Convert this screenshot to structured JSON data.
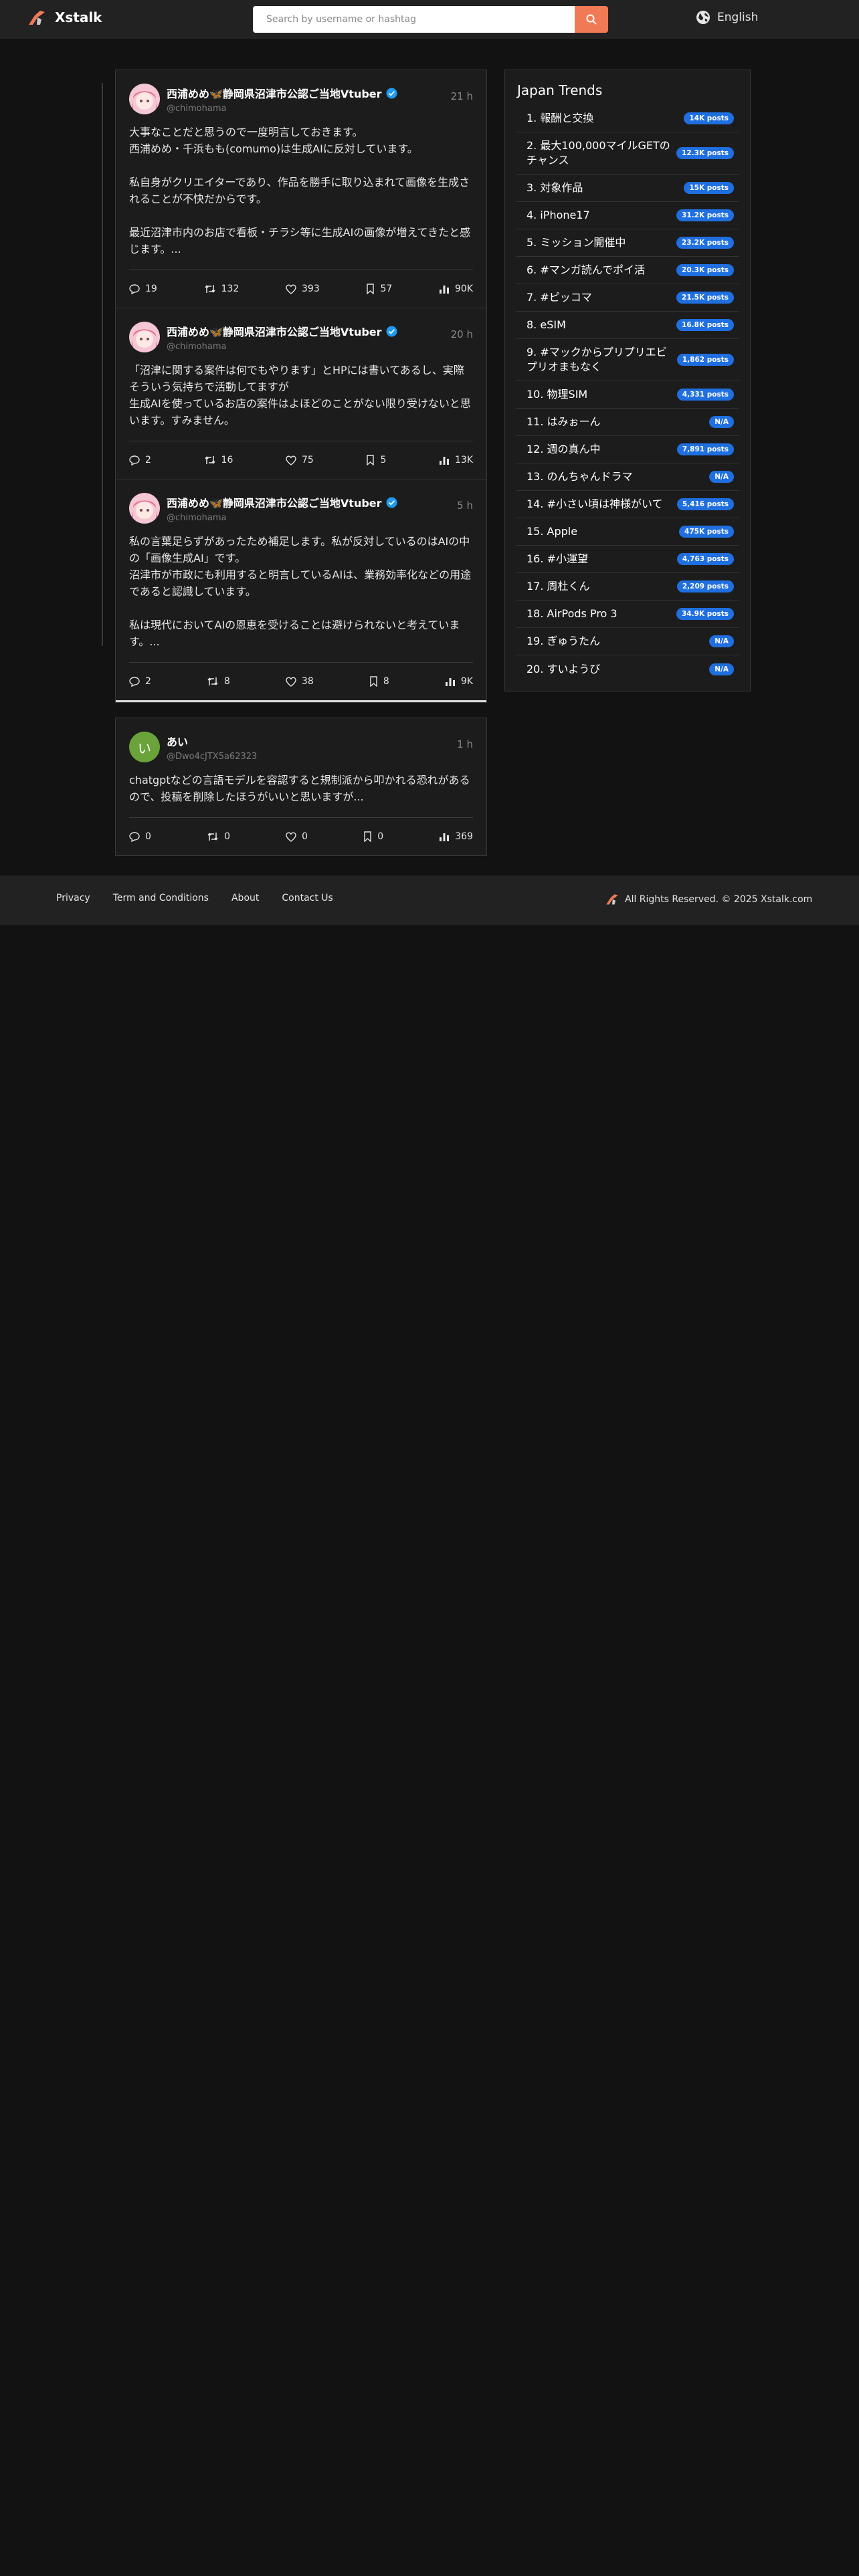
{
  "header": {
    "brand": "Xstalk",
    "search_placeholder": "Search by username or hashtag",
    "language": "English"
  },
  "thread_posts": [
    {
      "name": "西浦めめ🦋静岡県沼津市公認ご当地Vtuber",
      "handle": "@chimohama",
      "time": "21 h",
      "body": "大事なことだと思うので一度明言しておきます。\n西浦めめ・千浜もも(comumo)は生成AIに反対しています。\n\n私自身がクリエイターであり、作品を勝手に取り込まれて画像を生成されることが不快だからです。\n\n最近沼津市内のお店で看板・チラシ等に生成AIの画像が増えてきたと感じます。...",
      "replies": "19",
      "retweets": "132",
      "likes": "393",
      "bookmarks": "57",
      "views": "90K"
    },
    {
      "name": "西浦めめ🦋静岡県沼津市公認ご当地Vtuber",
      "handle": "@chimohama",
      "time": "20 h",
      "body": "「沼津に関する案件は何でもやります」とHPには書いてあるし、実際そういう気持ちで活動してますが\n生成AIを使っているお店の案件はよほどのことがない限り受けないと思います。すみません。",
      "replies": "2",
      "retweets": "16",
      "likes": "75",
      "bookmarks": "5",
      "views": "13K"
    },
    {
      "name": "西浦めめ🦋静岡県沼津市公認ご当地Vtuber",
      "handle": "@chimohama",
      "time": "5 h",
      "body": "私の言葉足らずがあったため補足します。私が反対しているのはAIの中の「画像生成AI」です。\n沼津市が市政にも利用すると明言しているAIは、業務効率化などの用途であると認識しています。\n\n私は現代においてAIの恩恵を受けることは避けられないと考えています。...",
      "replies": "2",
      "retweets": "8",
      "likes": "38",
      "bookmarks": "8",
      "views": "9K"
    }
  ],
  "single_post": {
    "avatar_letter": "い",
    "name": "あい",
    "handle": "@Dwo4cJTX5a62323",
    "time": "1 h",
    "body": "chatgptなどの言語モデルを容認すると規制派から叩かれる恐れがあるので、投稿を削除したほうがいいと思いますが...",
    "replies": "0",
    "retweets": "0",
    "likes": "0",
    "bookmarks": "0",
    "views": "369"
  },
  "trends": {
    "title": "Japan Trends",
    "items": [
      {
        "label": "1. 報酬と交換",
        "count": "14K posts"
      },
      {
        "label": "2. 最大100,000マイルGETのチャンス",
        "count": "12.3K posts"
      },
      {
        "label": "3. 対象作品",
        "count": "15K posts"
      },
      {
        "label": "4. iPhone17",
        "count": "31.2K posts"
      },
      {
        "label": "5. ミッション開催中",
        "count": "23.2K posts"
      },
      {
        "label": "6. #マンガ読んでポイ活",
        "count": "20.3K posts"
      },
      {
        "label": "7. #ピッコマ",
        "count": "21.5K posts"
      },
      {
        "label": "8. eSIM",
        "count": "16.8K posts"
      },
      {
        "label": "9. #マックからプリプリエビプリオまもなく",
        "count": "1,862 posts"
      },
      {
        "label": "10. 物理SIM",
        "count": "4,331 posts"
      },
      {
        "label": "11. はみぉーん",
        "count": "N/A"
      },
      {
        "label": "12. 週の真ん中",
        "count": "7,891 posts"
      },
      {
        "label": "13. のんちゃんドラマ",
        "count": "N/A"
      },
      {
        "label": "14. #小さい頃は神様がいて",
        "count": "5,416 posts"
      },
      {
        "label": "15. Apple",
        "count": "475K posts"
      },
      {
        "label": "16. #小運望",
        "count": "4,763 posts"
      },
      {
        "label": "17. 周杜くん",
        "count": "2,209 posts"
      },
      {
        "label": "18. AirPods Pro 3",
        "count": "34.9K posts"
      },
      {
        "label": "19. ぎゅうたん",
        "count": "N/A"
      },
      {
        "label": "20. すいようび",
        "count": "N/A"
      }
    ]
  },
  "footer": {
    "links": [
      "Privacy",
      "Term and Conditions",
      "About",
      "Contact Us"
    ],
    "copyright": "All Rights Reserved. © 2025 Xstalk.com"
  },
  "colors": {
    "accent": "#f07a55",
    "badge": "#1f6fe0",
    "verified": "#1d9bf0",
    "avatar_green": "#6aa33a"
  }
}
